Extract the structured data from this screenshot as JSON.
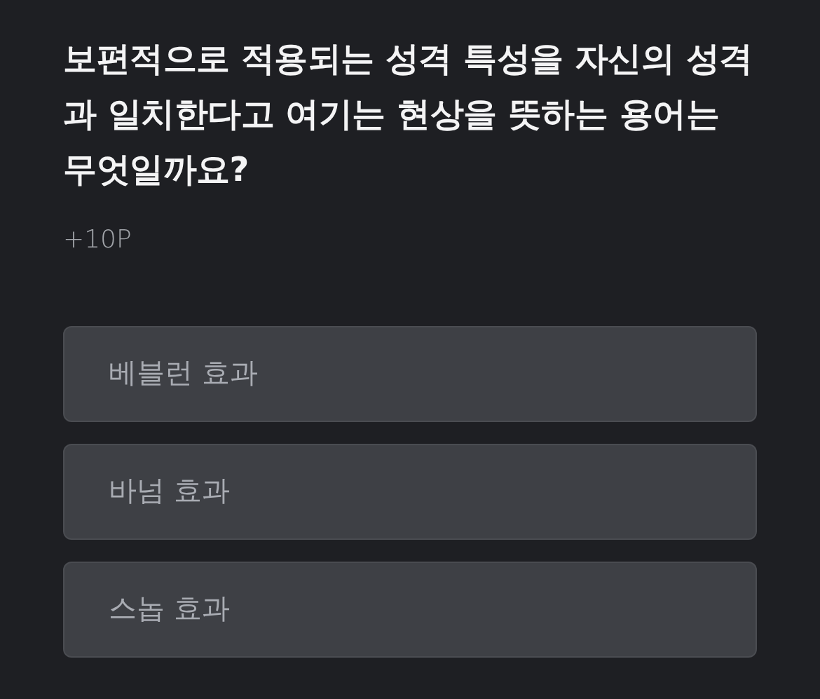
{
  "question": {
    "text": "보편적으로 적용되는 성격 특성을 자신의 성격과 일치한다고 여기는 현상을 뜻하는 용어는 무엇일까요?",
    "points": "+10P"
  },
  "options": [
    {
      "label": "베블런 효과"
    },
    {
      "label": "바넘 효과"
    },
    {
      "label": "스놉 효과"
    }
  ]
}
